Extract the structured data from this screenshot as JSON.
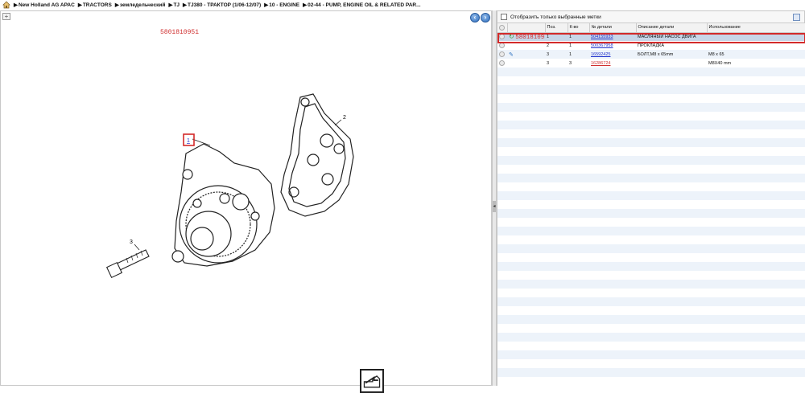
{
  "breadcrumb": {
    "items": [
      "New Holland AG APAC",
      "TRACTORS",
      "земледельческий",
      "TJ",
      "TJ380 - ТРАКТОР (1/06-12/07)",
      "10 - ENGINE",
      "02-44 - PUMP, ENGINE OIL & RELATED PAR..."
    ]
  },
  "diagram": {
    "part_number_label": "5801810951",
    "callouts": [
      "1",
      "2",
      "3"
    ]
  },
  "filter": {
    "label": "Отобразить только выбранные метки"
  },
  "table": {
    "headers": [
      "",
      "",
      "Поз.",
      "К-во",
      "№ детали",
      "Описание детали",
      "Использование"
    ],
    "rows": [
      {
        "extra": "5801810951",
        "pos": "1",
        "qty": "1",
        "part": "504155933",
        "desc": "МАСЛЯНЫЙ НАСОС ДВИГА",
        "usage": ""
      },
      {
        "extra": "",
        "pos": "2",
        "qty": "1",
        "part": "500367958",
        "desc": "ПРОКЛАДКА",
        "usage": ""
      },
      {
        "extra": "",
        "pos": "3",
        "qty": "1",
        "part": "16592425",
        "desc": "БОЛТ,M8 x 65mm",
        "usage": "M8 x 65"
      },
      {
        "extra": "",
        "pos": "3",
        "qty": "3",
        "part": "16286724",
        "desc": "",
        "usage": "M8X40 mm"
      }
    ]
  },
  "colors": {
    "accent_red": "#d32a2a",
    "link_blue": "#2233cc",
    "selected_row": "#c7d6e8"
  }
}
